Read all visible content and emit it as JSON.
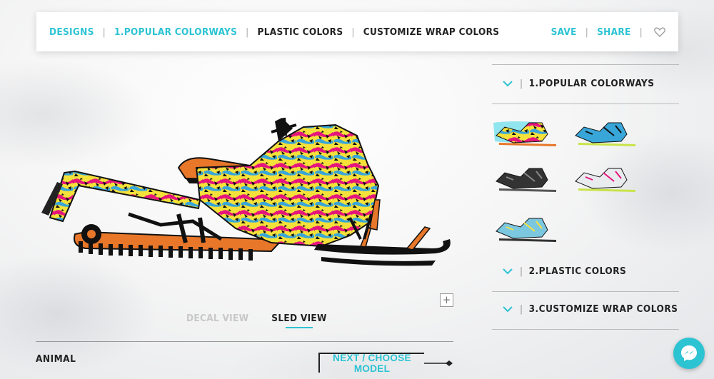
{
  "nav": {
    "designs": "DESIGNS",
    "popular": "1.POPULAR COLORWAYS",
    "plastic": "PLASTIC COLORS",
    "customize": "CUSTOMIZE WRAP COLORS",
    "save": "SAVE",
    "share": "SHARE",
    "separator": "|",
    "heart_icon": "heart-icon"
  },
  "colors": {
    "accent": "#2cc3d3",
    "text": "#222222",
    "track": "#e8772a",
    "magenta": "#e5157d",
    "yellow": "#f4e13a",
    "blue": "#38a6d8"
  },
  "viewer": {
    "zoom_symbol": "+",
    "tabs": [
      "DECAL VIEW",
      "SLED VIEW"
    ],
    "active_tab": "SLED VIEW"
  },
  "footer": {
    "design_name": "ANIMAL",
    "next_label": "NEXT / CHOOSE MODEL"
  },
  "panel": {
    "sections": [
      {
        "label": "1.POPULAR COLORWAYS",
        "expanded": true
      },
      {
        "label": "2.PLASTIC COLORS",
        "expanded": false
      },
      {
        "label": "3.CUSTOMIZE WRAP COLORS",
        "expanded": false
      }
    ],
    "bar": "|",
    "colorway_count": 5,
    "selected_colorway": 1
  },
  "messenger_icon": "messenger-icon"
}
